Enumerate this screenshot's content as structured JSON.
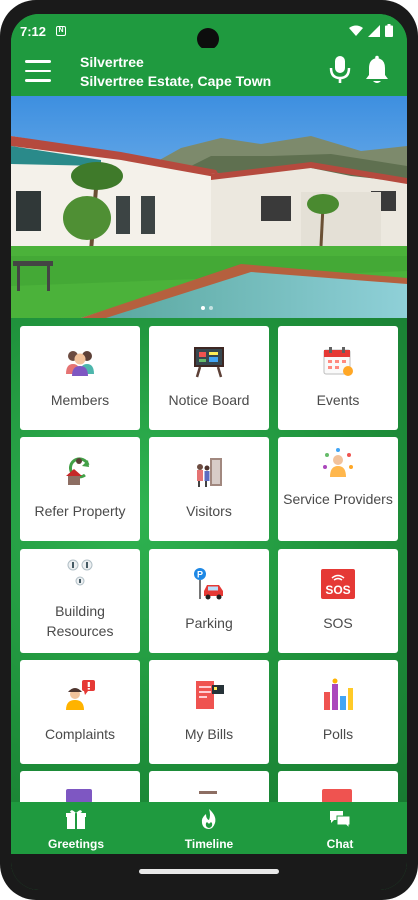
{
  "status_bar": {
    "time": "7:12",
    "notif_letter": "N"
  },
  "app_bar": {
    "title": "Silvertree",
    "subtitle": "Silvertree Estate, Cape Town"
  },
  "tiles": [
    {
      "label": "Members",
      "icon": "members-icon"
    },
    {
      "label": "Notice Board",
      "icon": "notice-board-icon"
    },
    {
      "label": "Events",
      "icon": "calendar-icon"
    },
    {
      "label": "Refer Property",
      "icon": "refer-property-icon"
    },
    {
      "label": "Visitors",
      "icon": "visitors-icon"
    },
    {
      "label": "Service Providers",
      "icon": "service-providers-icon"
    },
    {
      "label": "Building Resources",
      "icon": "building-resources-icon"
    },
    {
      "label": "Parking",
      "icon": "parking-icon"
    },
    {
      "label": "SOS",
      "icon": "sos-icon"
    },
    {
      "label": "Complaints",
      "icon": "complaints-icon"
    },
    {
      "label": "My Bills",
      "icon": "bills-icon"
    },
    {
      "label": "Polls",
      "icon": "polls-icon"
    }
  ],
  "sos_text": "SOS",
  "bottom_nav": [
    {
      "label": "Greetings",
      "icon": "greetings-icon"
    },
    {
      "label": "Timeline",
      "icon": "timeline-icon"
    },
    {
      "label": "Chat",
      "icon": "chat-icon"
    }
  ],
  "colors": {
    "brand_green": "#1f9a3f",
    "sos_red": "#e53935"
  }
}
